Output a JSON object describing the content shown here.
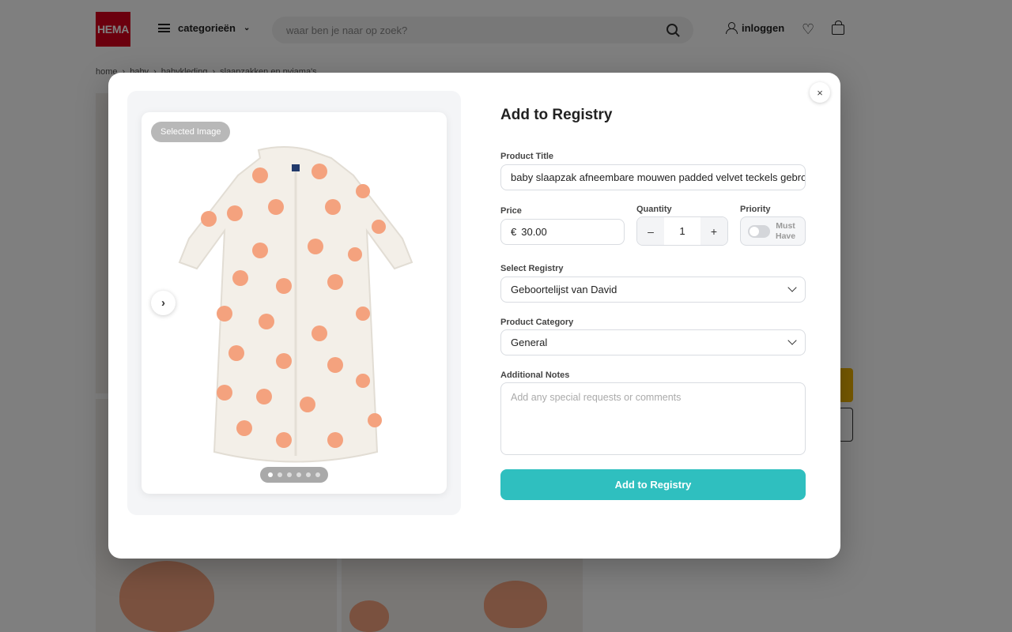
{
  "header": {
    "logo_text": "HEMA",
    "categories_label": "categorieën",
    "search_placeholder": "waar ben je naar op zoek?",
    "login_label": "inloggen"
  },
  "breadcrumb": [
    "home",
    "baby",
    "babykleding",
    "slaapzakken en pyjama's"
  ],
  "modal": {
    "title": "Add to Registry",
    "close_label": "×",
    "image": {
      "badge": "Selected Image",
      "next_label": "›",
      "dot_count": 6,
      "active_dot": 0
    },
    "fields": {
      "product_title_label": "Product Title",
      "product_title_value": "baby slaapzak afneembare mouwen padded velvet teckels  gebroken wit",
      "price_label": "Price",
      "price_currency": "€",
      "price_value": "30.00",
      "quantity_label": "Quantity",
      "quantity_value": "1",
      "quantity_minus": "–",
      "quantity_plus": "+",
      "priority_label": "Priority",
      "priority_toggle_line1": "Must",
      "priority_toggle_line2": "Have",
      "registry_label": "Select Registry",
      "registry_value": "Geboortelijst van David",
      "category_label": "Product Category",
      "category_value": "General",
      "notes_label": "Additional Notes",
      "notes_placeholder": "Add any special requests or comments"
    },
    "submit_label": "Add to Registry"
  },
  "colors": {
    "brand": "#d6001c",
    "accent": "#2fbfbf",
    "dog": "#f4a27e",
    "garment": "#f3efe8"
  }
}
